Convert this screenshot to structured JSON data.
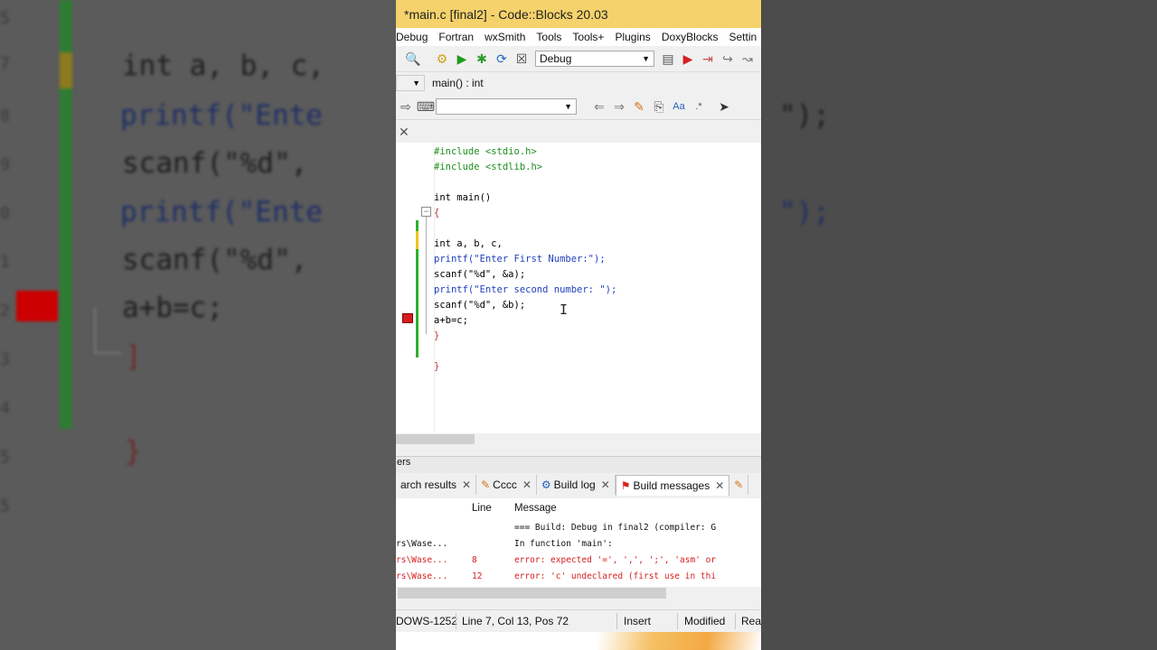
{
  "window": {
    "title": "*main.c [final2] - Code::Blocks 20.03"
  },
  "menu": [
    "Debug",
    "Fortran",
    "wxSmith",
    "Tools",
    "Tools+",
    "Plugins",
    "DoxyBlocks",
    "Settin"
  ],
  "toolbar": {
    "build_target": "Debug",
    "scope": "main() : int",
    "search_value": ""
  },
  "editor": {
    "lines": [
      "#include <stdio.h>",
      "#include <stdlib.h>",
      "",
      "int main()",
      "{",
      "",
      "int a, b, c,",
      "printf(\"Enter First Number:\");",
      "scanf(\"%d\", &a);",
      "printf(\"Enter second number: \");",
      "scanf(\"%d\", &b);",
      "a+b=c;",
      "}",
      "",
      "}"
    ]
  },
  "panel": {
    "title": "ers",
    "tabs": [
      {
        "label": "arch results"
      },
      {
        "label": "Cccc"
      },
      {
        "label": "Build log"
      },
      {
        "label": "Build messages"
      }
    ],
    "columns": {
      "file": "",
      "line": "Line",
      "message": "Message"
    },
    "rows": [
      {
        "file": "",
        "line": "",
        "message": "=== Build: Debug in final2 (compiler: G",
        "type": "info"
      },
      {
        "file": "rs\\Wase...",
        "line": "",
        "message": "In function 'main':",
        "type": "info"
      },
      {
        "file": "rs\\Wase...",
        "line": "8",
        "message": "error: expected '=', ',', ';', 'asm' or",
        "type": "error"
      },
      {
        "file": "rs\\Wase...",
        "line": "12",
        "message": "error: 'c' undeclared (first use in thi",
        "type": "error"
      }
    ]
  },
  "status": {
    "encoding": "DOWS-1252",
    "position": "Line 7, Col 13, Pos 72",
    "mode": "Insert",
    "modified": "Modified",
    "access": "Read"
  },
  "background": {
    "lines": [
      "int a, b, c,",
      "printf(\"Ente",
      "scanf(\"%d\",",
      "printf(\"Ente",
      "scanf(\"%d\",",
      "a+b=c;"
    ],
    "right": [
      "\");",
      "\");"
    ],
    "numbers": [
      "5",
      "7",
      "8",
      "9",
      "0",
      "1",
      "2",
      "3",
      "4",
      "5",
      "5"
    ]
  },
  "colors": {
    "title_bar": "#f5d26b",
    "error": "#d62020",
    "preprocessor": "#1f8f1f",
    "string": "#1f3fbf",
    "change_bar": "#2db02d"
  }
}
